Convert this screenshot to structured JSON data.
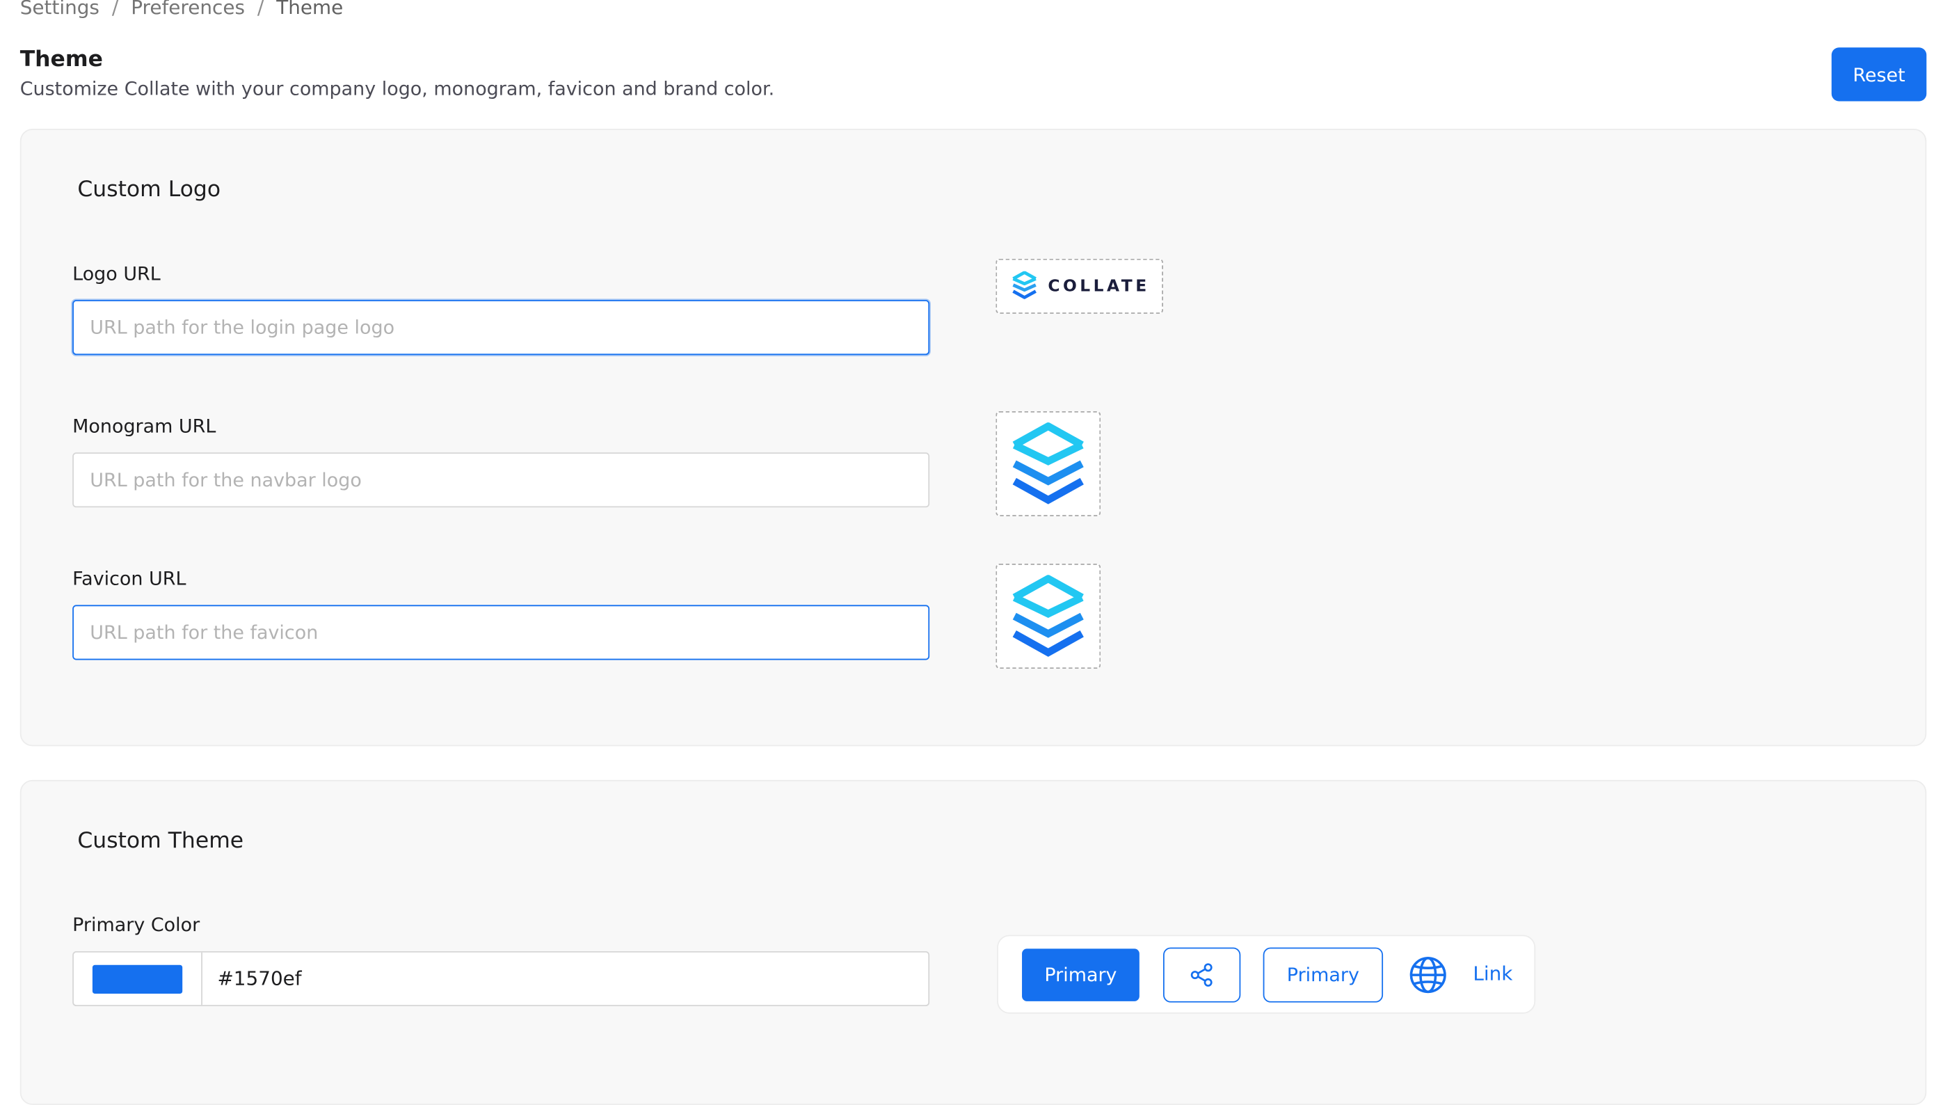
{
  "breadcrumb": {
    "items": [
      "Settings",
      "Preferences",
      "Theme"
    ],
    "separator": "/"
  },
  "header": {
    "title": "Theme",
    "subtitle": "Customize Collate with your company logo, monogram, favicon and brand color.",
    "reset_label": "Reset"
  },
  "custom_logo": {
    "title": "Custom Logo",
    "logo_url": {
      "label": "Logo URL",
      "value": "",
      "placeholder": "URL path for the login page logo"
    },
    "monogram_url": {
      "label": "Monogram URL",
      "value": "",
      "placeholder": "URL path for the navbar logo"
    },
    "favicon_url": {
      "label": "Favicon URL",
      "value": "",
      "placeholder": "URL path for the favicon"
    },
    "logo_preview_text": "COLLATE"
  },
  "custom_theme": {
    "title": "Custom Theme",
    "primary_color": {
      "label": "Primary Color",
      "value": "#1570ef"
    },
    "preview": {
      "primary_button_label": "Primary",
      "share_icon": "share-icon",
      "outline_button_label": "Primary",
      "globe_icon": "globe-icon",
      "link_label": "Link"
    }
  },
  "colors": {
    "accent": "#1570ef",
    "logo_cyan": "#22c7f2",
    "logo_blue": "#1570ef",
    "logo_text": "#1a1d3b"
  }
}
